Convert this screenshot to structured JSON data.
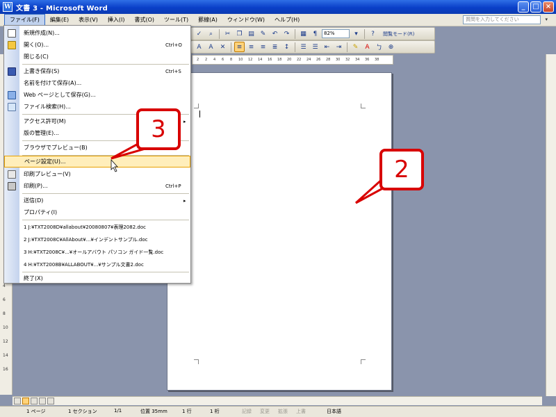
{
  "window": {
    "title": "文書 3 - Microsoft Word",
    "icon_letter": "W",
    "buttons": [
      "minimize-icon",
      "maximize-icon",
      "close-icon"
    ]
  },
  "menubar": {
    "items": [
      "ファイル(F)",
      "編集(E)",
      "表示(V)",
      "挿入(I)",
      "書式(O)",
      "ツール(T)",
      "罫線(A)",
      "ウィンドウ(W)",
      "ヘルプ(H)"
    ],
    "active_index": 0,
    "help_placeholder": "質問を入力してください",
    "help_drop_icon": "chevron-down-icon"
  },
  "toolbar": {
    "zoom": "82%",
    "read_mode": "閲覧モード(R)"
  },
  "file_menu": {
    "items": [
      {
        "label": "新規作成(N)...",
        "shortcut": "",
        "icon": "new-document-icon",
        "submenu": false
      },
      {
        "label": "開く(O)...",
        "shortcut": "Ctrl+O",
        "icon": "open-folder-icon",
        "submenu": false
      },
      {
        "label": "閉じる(C)",
        "shortcut": "",
        "icon": "",
        "submenu": false
      },
      {
        "label": "上書き保存(S)",
        "shortcut": "Ctrl+S",
        "icon": "save-icon",
        "submenu": false
      },
      {
        "label": "名前を付けて保存(A)...",
        "shortcut": "",
        "icon": "",
        "submenu": false
      },
      {
        "label": "Web ページとして保存(G)...",
        "shortcut": "",
        "icon": "web-page-icon",
        "submenu": false
      },
      {
        "label": "ファイル検索(H)...",
        "shortcut": "",
        "icon": "file-search-icon",
        "submenu": false
      },
      {
        "label": "アクセス許可(M)",
        "shortcut": "",
        "icon": "",
        "submenu": true
      },
      {
        "label": "版の管理(E)...",
        "shortcut": "",
        "icon": "",
        "submenu": false
      },
      {
        "label": "ブラウザでプレビュー(B)",
        "shortcut": "",
        "icon": "",
        "submenu": false
      },
      {
        "label": "ページ設定(U)...",
        "shortcut": "",
        "icon": "",
        "submenu": false,
        "selected": true
      },
      {
        "label": "印刷プレビュー(V)",
        "shortcut": "",
        "icon": "print-preview-icon",
        "submenu": false
      },
      {
        "label": "印刷(P)...",
        "shortcut": "Ctrl+P",
        "icon": "print-icon",
        "submenu": false
      },
      {
        "label": "送信(D)",
        "shortcut": "",
        "icon": "",
        "submenu": true
      },
      {
        "label": "プロパティ(I)",
        "shortcut": "",
        "icon": "",
        "submenu": false
      },
      {
        "label": "1 J:¥TXT2008D¥allabout¥20080807¥表理2082.doc",
        "shortcut": "",
        "icon": "",
        "submenu": false
      },
      {
        "label": "2 J:¥TXT2008C¥AllAbout¥...¥インデントサンプル.doc",
        "shortcut": "",
        "icon": "",
        "submenu": false
      },
      {
        "label": "3 H:¥TXT2008C¥...¥オールアバウト パソコン ガイド一覧.doc",
        "shortcut": "",
        "icon": "",
        "submenu": false
      },
      {
        "label": "4 H:¥TXT2008B¥ALLABOUT¥...¥サンプル文書2.doc",
        "shortcut": "",
        "icon": "",
        "submenu": false
      },
      {
        "label": "終了(X)",
        "shortcut": "",
        "icon": "",
        "submenu": false
      }
    ]
  },
  "callouts": {
    "step3": "3",
    "step2": "2"
  },
  "statusbar": {
    "page": "1 ページ",
    "section": "1 セクション",
    "page_count": "1/1",
    "position": "位置 35mm",
    "line": "1 行",
    "column": "1 桁",
    "rec": "記録",
    "track": "変更",
    "ext": "拡張",
    "ovr": "上書",
    "language": "日本語"
  }
}
